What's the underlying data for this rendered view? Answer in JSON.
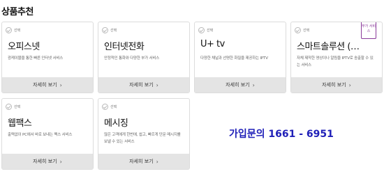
{
  "section": {
    "title": "상품추천"
  },
  "cards": [
    {
      "check_label": "선택",
      "title": "오피스넷",
      "desc": "광케이블을 통한 빠른 인터넷 서비스",
      "more_label": "자세히 보기"
    },
    {
      "check_label": "선택",
      "title": "인터넷전화",
      "desc": "안정적인 통화와 다양한 부가 서비스",
      "more_label": "자세히 보기"
    },
    {
      "check_label": "선택",
      "title": "U+ tv",
      "desc": "다양한 채널과 선명한 화질을 제공하는 IPTV",
      "more_label": "자세히 보기"
    },
    {
      "check_label": "선택",
      "title": "스마트솔루션 (…",
      "desc": "자체 제작한 영상이나 알림을 IPTV로 송출할 수 있는 서비스",
      "more_label": "자세히 보기",
      "badge": "부가 서비스"
    },
    {
      "check_label": "선택",
      "title": "웹팩스",
      "desc": "출력없이 PC에서 바로 보내는 팩스 서비스",
      "more_label": "자세히 보기"
    },
    {
      "check_label": "선택",
      "title": "메시징",
      "desc": "많은 고객에게 한번에, 쉽고, 빠르게 단문 메시지를 보낼 수 있는 서비스",
      "more_label": "자세히 보기"
    }
  ],
  "contact": {
    "text": "가입문의 1661 - 6951"
  },
  "colors": {
    "contact": "#2020b8",
    "badge": "#8a3a9a",
    "more_bg": "#e4e4e4",
    "border": "#dcdcdc"
  }
}
